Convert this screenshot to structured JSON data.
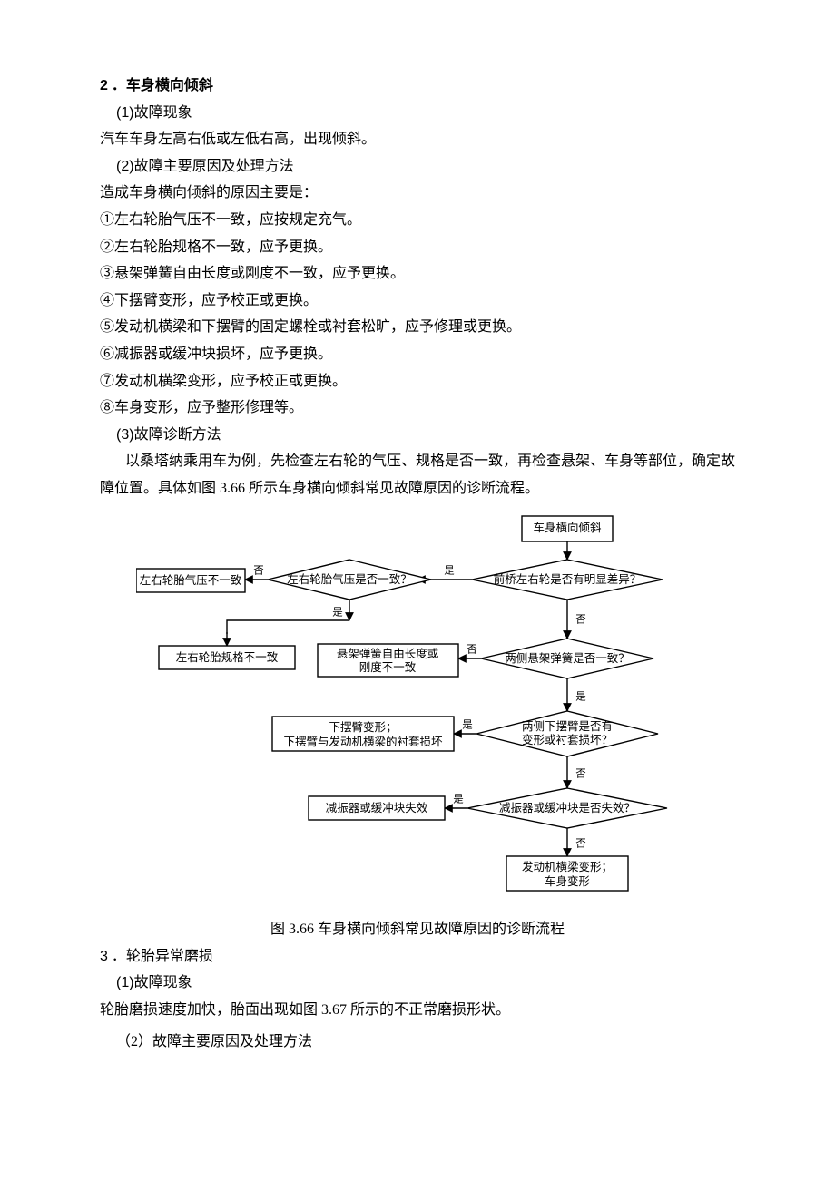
{
  "h2": {
    "num": "2",
    "title": "．车身横向倾斜"
  },
  "s2": {
    "sub1": {
      "n": "(1)",
      "t": "故障现象"
    },
    "sub1_text": "汽车车身左高右低或左低右高，出现倾斜。",
    "sub2": {
      "n": "(2)",
      "t": "故障主要原因及处理方法"
    },
    "sub2_text": "造成车身横向倾斜的原因主要是：",
    "items": [
      "①左右轮胎气压不一致，应按规定充气。",
      "②左右轮胎规格不一致，应予更换。",
      "③悬架弹簧自由长度或刚度不一致，应予更换。",
      "④下摆臂变形，应予校正或更换。",
      "⑤发动机横梁和下摆臂的固定螺栓或衬套松旷，应予修理或更换。",
      "⑥减振器或缓冲块损坏，应予更换。",
      "⑦发动机横梁变形，应予校正或更换。",
      "⑧车身变形，应予整形修理等。"
    ],
    "sub3": {
      "n": "(3)",
      "t": "故障诊断方法"
    },
    "sub3_text": "以桑塔纳乘用车为例，先检查左右轮的气压、规格是否一致，再检查悬架、车身等部位，确定故障位置。具体如图 3.66 所示车身横向倾斜常见故障原因的诊断流程。"
  },
  "caption1": "图 3.66 车身横向倾斜常见故障原因的诊断流程",
  "h3": {
    "num": "3",
    "title": "．轮胎异常磨损"
  },
  "s3": {
    "sub1": {
      "n": "(1)",
      "t": "故障现象"
    },
    "sub1_text": "轮胎磨损速度加快，胎面出现如图 3.67 所示的不正常磨损形状。",
    "sub2": {
      "n": "（2）",
      "t": "故障主要原因及处理方法"
    }
  },
  "chart_data": {
    "type": "flowchart",
    "title": "车身横向倾斜常见故障原因的诊断流程",
    "start": "n0",
    "nodes": [
      {
        "id": "n0",
        "type": "terminal",
        "text": "车身横向倾斜"
      },
      {
        "id": "d1",
        "type": "decision",
        "text": "前桥左右轮是否有明显差异？"
      },
      {
        "id": "d2",
        "type": "decision",
        "text": "左右轮胎气压是否一致？"
      },
      {
        "id": "r1",
        "type": "result",
        "text": "左右轮胎气压不一致"
      },
      {
        "id": "r2",
        "type": "result",
        "text": "左右轮胎规格不一致"
      },
      {
        "id": "d3",
        "type": "decision",
        "text": "两侧悬架弹簧是否一致？"
      },
      {
        "id": "r3",
        "type": "result",
        "text": "悬架弹簧自由长度或刚度不一致"
      },
      {
        "id": "d4",
        "type": "decision",
        "text": "两侧下摆臂是否有变形或衬套损坏？"
      },
      {
        "id": "r4",
        "type": "result",
        "text": "下摆臂变形；下摆臂与发动机横梁的衬套损坏"
      },
      {
        "id": "d5",
        "type": "decision",
        "text": "减振器或缓冲块是否失效？"
      },
      {
        "id": "r5",
        "type": "result",
        "text": "减振器或缓冲块失效"
      },
      {
        "id": "r6",
        "type": "result",
        "text": "发动机横梁变形；车身变形"
      }
    ],
    "edges": [
      {
        "from": "n0",
        "to": "d1"
      },
      {
        "from": "d1",
        "to": "d2",
        "label": "是"
      },
      {
        "from": "d2",
        "to": "r1",
        "label": "否"
      },
      {
        "from": "d2",
        "to": "r2",
        "label": "是"
      },
      {
        "from": "d1",
        "to": "d3",
        "label": "否"
      },
      {
        "from": "d3",
        "to": "r3",
        "label": "否"
      },
      {
        "from": "d3",
        "to": "d4",
        "label": "是"
      },
      {
        "from": "d4",
        "to": "r4",
        "label": "是"
      },
      {
        "from": "d4",
        "to": "d5",
        "label": "否"
      },
      {
        "from": "d5",
        "to": "r5",
        "label": "是"
      },
      {
        "from": "d5",
        "to": "r6",
        "label": "否"
      }
    ],
    "labels": {
      "yes": "是",
      "no": "否"
    }
  }
}
